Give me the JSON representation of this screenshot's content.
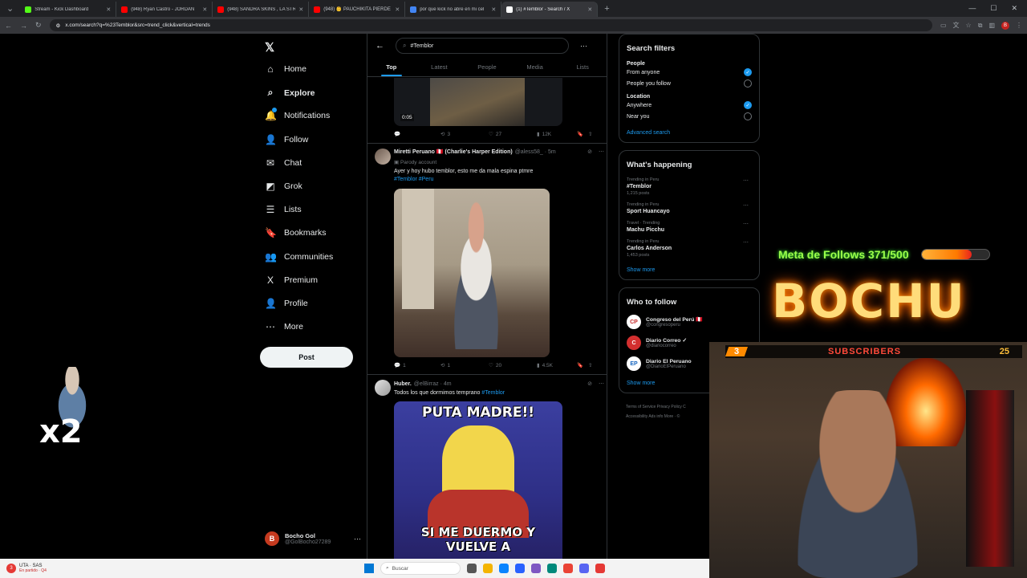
{
  "browser": {
    "tabs": [
      {
        "label": "Stream - Kick Dashboard",
        "color": "#53fc18"
      },
      {
        "label": "(948) Ryan Castro - JORDAN",
        "color": "#ff0000"
      },
      {
        "label": "(948) SANDRA SKINS , LA STR",
        "color": "#ff0000"
      },
      {
        "label": "(948) 👶 PAUCHIKITA PIERDE L",
        "color": "#ff0000"
      },
      {
        "label": "por que kick no abre en mi cel",
        "color": "#4285f4"
      },
      {
        "label": "(1) #Temblor - Search / X",
        "color": "#ffffff"
      }
    ],
    "url": "x.com/search?q=%23Temblor&src=trend_click&vertical=trends"
  },
  "nav": {
    "items": [
      {
        "label": "Home",
        "icon": "home-icon",
        "glyph": "⌂"
      },
      {
        "label": "Explore",
        "icon": "search-icon",
        "glyph": "⌕",
        "bold": true
      },
      {
        "label": "Notifications",
        "icon": "bell-icon",
        "glyph": "🔔"
      },
      {
        "label": "Follow",
        "icon": "follow-icon",
        "glyph": "👤"
      },
      {
        "label": "Chat",
        "icon": "mail-icon",
        "glyph": "✉"
      },
      {
        "label": "Grok",
        "icon": "grok-icon",
        "glyph": "◩"
      },
      {
        "label": "Lists",
        "icon": "lists-icon",
        "glyph": "☰"
      },
      {
        "label": "Bookmarks",
        "icon": "bookmark-icon",
        "glyph": "🔖"
      },
      {
        "label": "Communities",
        "icon": "communities-icon",
        "glyph": "👥"
      },
      {
        "label": "Premium",
        "icon": "x-icon",
        "glyph": "X"
      },
      {
        "label": "Profile",
        "icon": "profile-icon",
        "glyph": "👤"
      },
      {
        "label": "More",
        "icon": "more-icon",
        "glyph": "⋯"
      }
    ],
    "post_label": "Post",
    "account": {
      "initial": "B",
      "name": "Bocho Gol",
      "handle": "@GolBocho27289"
    }
  },
  "search": {
    "query": "#Temblor",
    "tabs": [
      "Top",
      "Latest",
      "People",
      "Media",
      "Lists"
    ],
    "active_tab": "Top"
  },
  "feed": {
    "video": {
      "time": "0:05",
      "replies": "",
      "reposts": "3",
      "likes": "27",
      "views": "12K"
    },
    "tweet1": {
      "name": "Miretti Peruano 🇵🇪 (Charlie's Harper Edition)",
      "handle": "@aless58_ · 5m",
      "label": "Parody account",
      "text": "Ayer y hoy hubo temblor, esto me da mala espina ptmre",
      "tags": "#Temblor #Peru",
      "replies": "1",
      "reposts": "1",
      "likes": "20",
      "views": "4.5K"
    },
    "tweet2": {
      "name": "Huber.",
      "handle": "@elBirraz · 4m",
      "text": "Todos los que dormimos temprano",
      "tag": "#Temblor",
      "meme_top": "PUTA MADRE!!",
      "meme_bottom": "SI ME DUERMO Y VUELVE A"
    }
  },
  "filters": {
    "title": "Search filters",
    "people_h": "People",
    "people": [
      {
        "label": "From anyone",
        "on": true
      },
      {
        "label": "People you follow",
        "on": false
      }
    ],
    "location_h": "Location",
    "location": [
      {
        "label": "Anywhere",
        "on": true
      },
      {
        "label": "Near you",
        "on": false
      }
    ],
    "advanced": "Advanced search"
  },
  "happening": {
    "title": "What's happening",
    "trends": [
      {
        "context": "Trending in Peru",
        "title": "#Temblor",
        "posts": "1,215 posts"
      },
      {
        "context": "Trending in Peru",
        "title": "Sport Huancayo",
        "posts": ""
      },
      {
        "context": "Travel · Trending",
        "title": "Machu Picchu",
        "posts": ""
      },
      {
        "context": "Trending in Peru",
        "title": "Carlos Anderson",
        "posts": "1,453 posts"
      }
    ],
    "show_more": "Show more"
  },
  "who_to_follow": {
    "title": "Who to follow",
    "accounts": [
      {
        "name": "Congreso del Perú 🇵🇪",
        "handle": "@congresoperu",
        "initial": "CP"
      },
      {
        "name": "Diario Correo ✓",
        "handle": "@diariocorreo",
        "initial": "C"
      },
      {
        "name": "Diario El Peruano",
        "handle": "@DiarioElPeruano",
        "initial": "EP"
      }
    ],
    "show_more": "Show more",
    "footer1": "Terms of Service   Privacy Policy   C",
    "footer2": "Accessibility   Ads info   More ·   ©"
  },
  "overlay": {
    "meta": "Meta de Follows 371/500",
    "meta_progress": 0.742,
    "brand": "BOCHU",
    "sub_left": "3",
    "sub_label": "SUBSCRIBERS",
    "sub_right": "25",
    "multiplier": "x2"
  },
  "taskbar": {
    "app": "UTA · SAS",
    "status": "En partido · Q4",
    "search": "Buscar"
  }
}
